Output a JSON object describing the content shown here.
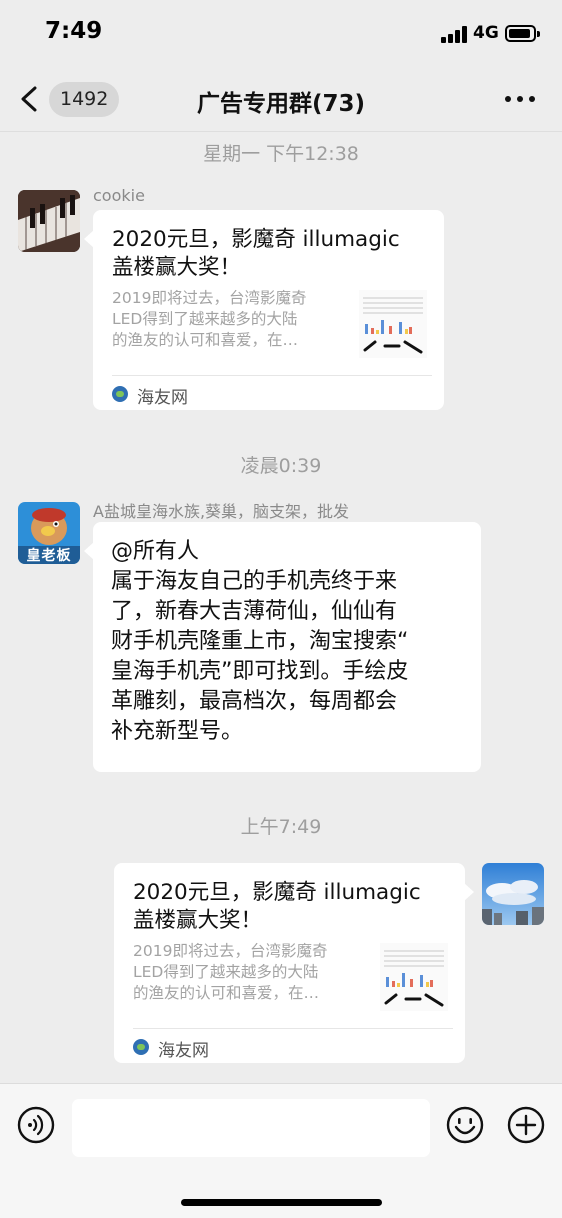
{
  "status_bar": {
    "time": "7:49",
    "network": "4G"
  },
  "nav": {
    "unread_count": "1492",
    "title": "广告专用群(73)"
  },
  "messages": [
    {
      "timestamp": "星期一 下午12:38",
      "sender": "cookie",
      "card": {
        "title_lines": [
          "2020元旦，影魔奇 illumagic",
          "盖楼赢大奖！"
        ],
        "desc_lines": [
          "2019即将过去，台湾影魔奇",
          "LED得到了越来越多的大陆",
          "的渔友的认可和喜爱，在…"
        ],
        "source": "海友网"
      }
    },
    {
      "timestamp": "凌晨0:39",
      "sender": "A盐城皇海水族,葵巢，脑支架，批发",
      "avatar_text": "皇老板",
      "text_lines": [
        "@所有人",
        "属于海友自己的手机壳终于来",
        "了，新春大吉薄荷仙，仙仙有",
        "财手机壳隆重上市，淘宝搜索“",
        "皇海手机壳”即可找到。手绘皮",
        "革雕刻，最高档次，每周都会",
        "补充新型号。"
      ]
    },
    {
      "timestamp": "上午7:49",
      "card": {
        "title_lines": [
          "2020元旦，影魔奇 illumagic",
          "盖楼赢大奖！"
        ],
        "desc_lines": [
          "2019即将过去，台湾影魔奇",
          "LED得到了越来越多的大陆",
          "的渔友的认可和喜爱，在…"
        ],
        "source": "海友网"
      }
    }
  ],
  "input": {
    "value": ""
  }
}
